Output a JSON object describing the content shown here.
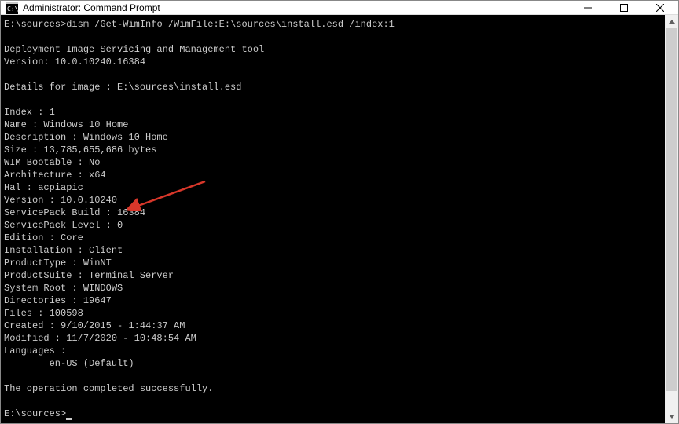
{
  "titlebar": {
    "title": "Administrator: Command Prompt"
  },
  "terminal": {
    "prompt1_path": "E:\\sources>",
    "prompt1_cmd": "dism /Get-WimInfo /WimFile:E:\\sources\\install.esd /index:1",
    "tool_name": "Deployment Image Servicing and Management tool",
    "tool_version": "Version: 10.0.10240.16384",
    "details_header": "Details for image : E:\\sources\\install.esd",
    "lines": {
      "index": "Index : 1",
      "name": "Name : Windows 10 Home",
      "description": "Description : Windows 10 Home",
      "size": "Size : 13,785,655,686 bytes",
      "wim_bootable": "WIM Bootable : No",
      "architecture": "Architecture : x64",
      "hal": "Hal : acpiapic",
      "version": "Version : 10.0.10240",
      "sp_build": "ServicePack Build : 16384",
      "sp_level": "ServicePack Level : 0",
      "edition": "Edition : Core",
      "installation": "Installation : Client",
      "product_type": "ProductType : WinNT",
      "product_suite": "ProductSuite : Terminal Server",
      "system_root": "System Root : WINDOWS",
      "directories": "Directories : 19647",
      "files": "Files : 100598",
      "created": "Created : 9/10/2015 - 1:44:37 AM",
      "modified": "Modified : 11/7/2020 - 10:48:54 AM",
      "languages": "Languages :",
      "lang_entry": "        en-US (Default)"
    },
    "success": "The operation completed successfully.",
    "prompt2_path": "E:\\sources>"
  },
  "annotation": {
    "arrow_color": "#d8372a"
  }
}
